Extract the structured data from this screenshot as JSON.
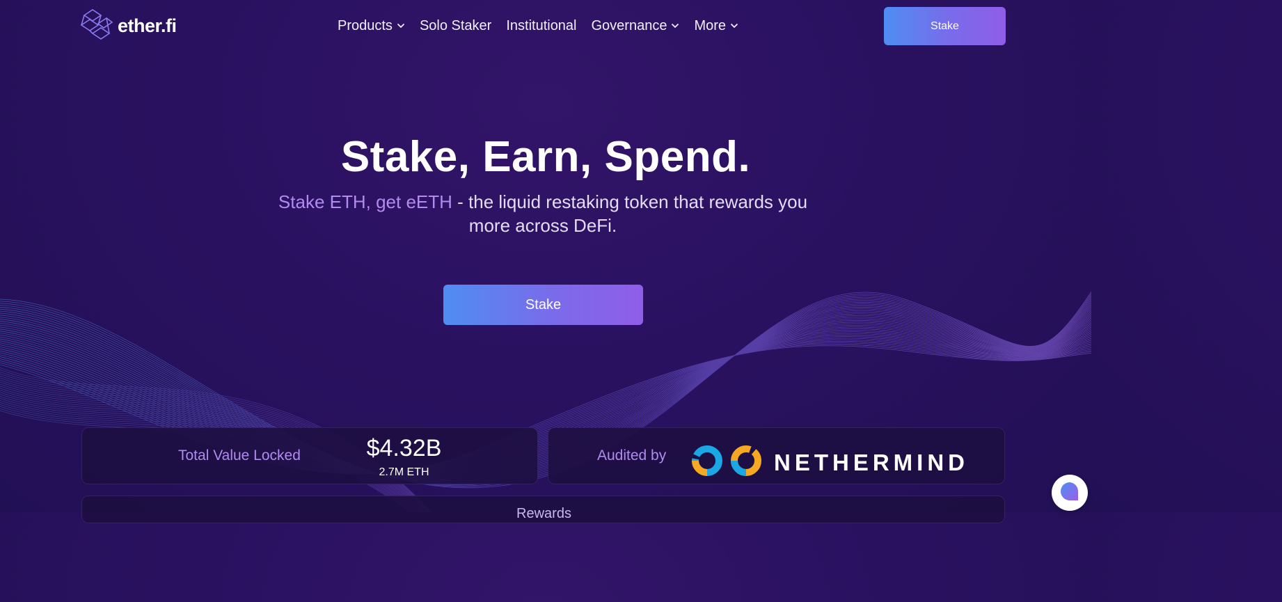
{
  "brand": {
    "name": "ether.fi"
  },
  "nav": {
    "items": [
      {
        "label": "Products",
        "has_dropdown": true
      },
      {
        "label": "Solo Staker",
        "has_dropdown": false
      },
      {
        "label": "Institutional",
        "has_dropdown": false
      },
      {
        "label": "Governance",
        "has_dropdown": true
      },
      {
        "label": "More",
        "has_dropdown": true
      }
    ],
    "stake_label": "Stake"
  },
  "hero": {
    "title": "Stake, Earn, Spend.",
    "subtitle_accent": "Stake ETH, get eETH",
    "subtitle_rest": " - the liquid restaking token that rewards you more across DeFi.",
    "cta_label": "Stake"
  },
  "stats": {
    "tvl_label": "Total Value Locked",
    "tvl_value": "$4.32B",
    "tvl_sub": "2.7M ETH",
    "audited_label": "Audited by",
    "auditor_name": "NETHERMIND"
  },
  "next_section": {
    "label": "Rewards"
  },
  "icons": {
    "logo": "etherfi-logo-icon",
    "chevron": "chevron-down-icon",
    "auditor": "nethermind-logo-icon",
    "chat": "chat-bubble-icon"
  },
  "colors": {
    "background": "#2a1160",
    "accent_text": "#b18bf0",
    "button_gradient_start": "#4f8df2",
    "button_gradient_end": "#8f5ee8",
    "auditor_blue": "#1aa7e4",
    "auditor_orange": "#f7a823"
  }
}
